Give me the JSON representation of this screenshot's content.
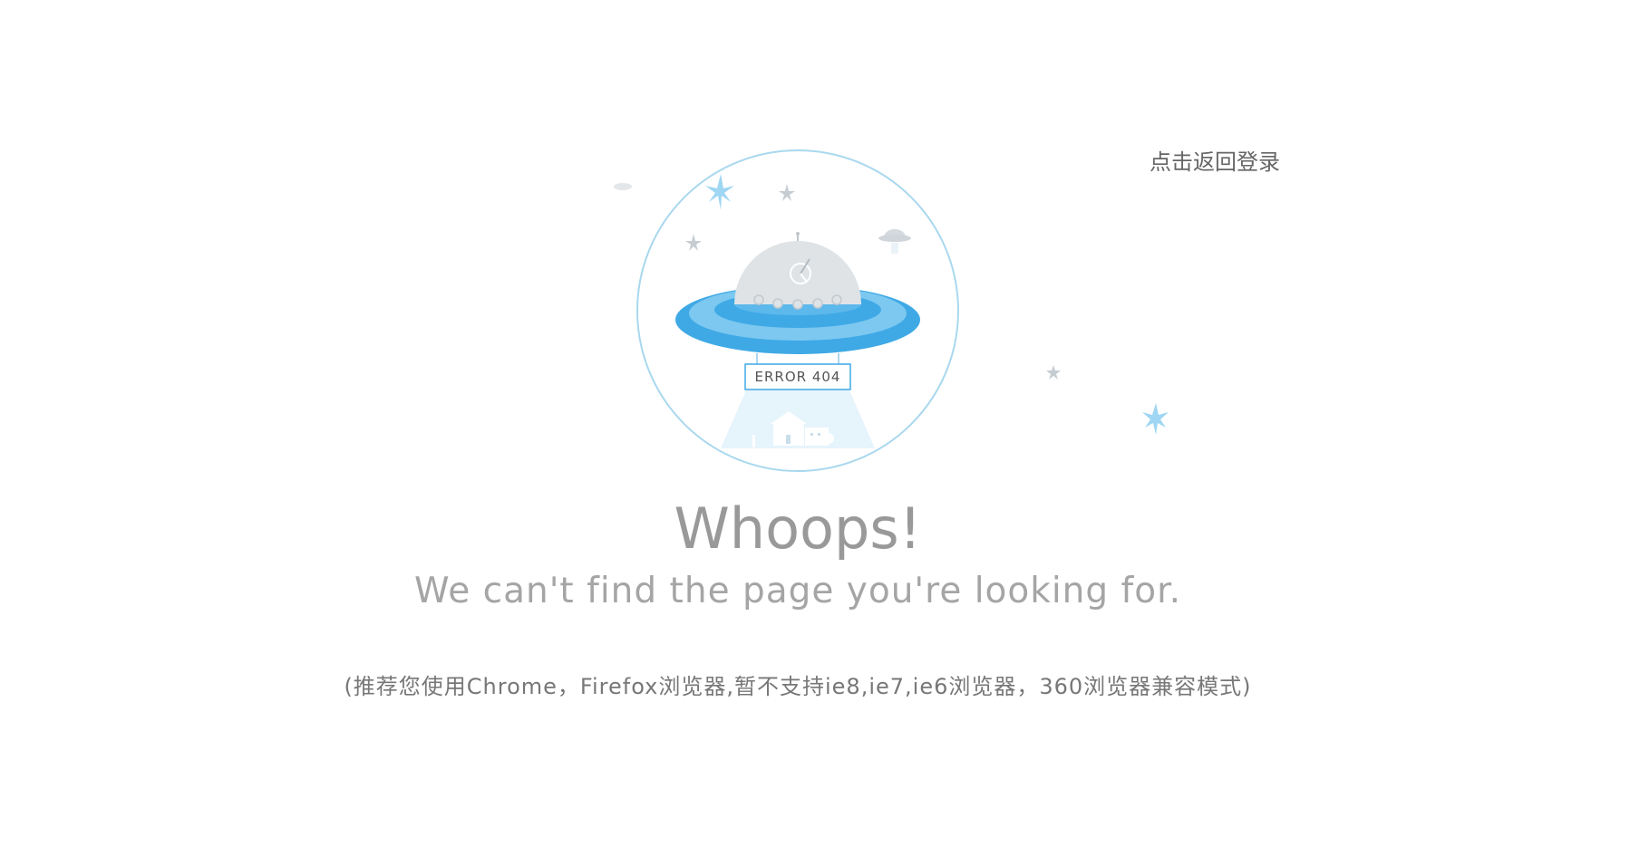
{
  "nav": {
    "back_login_label": "点击返回登录"
  },
  "illustration": {
    "sign_text": "ERROR 404",
    "colors": {
      "ring": "#a9d8ee",
      "saucer_outer": "#3fa9e6",
      "saucer_inner": "#7cc8f0",
      "dome": "#dfe3e6",
      "beam": "#e6f4fc",
      "star_blue": "#9fd6f3",
      "star_grey": "#c5ccd2"
    }
  },
  "message": {
    "headline": "Whoops!",
    "subhead": "We can't find the page you're looking for.",
    "browser_note": "(推荐您使用Chrome，Firefox浏览器,暂不支持ie8,ie7,ie6浏览器，360浏览器兼容模式)"
  }
}
